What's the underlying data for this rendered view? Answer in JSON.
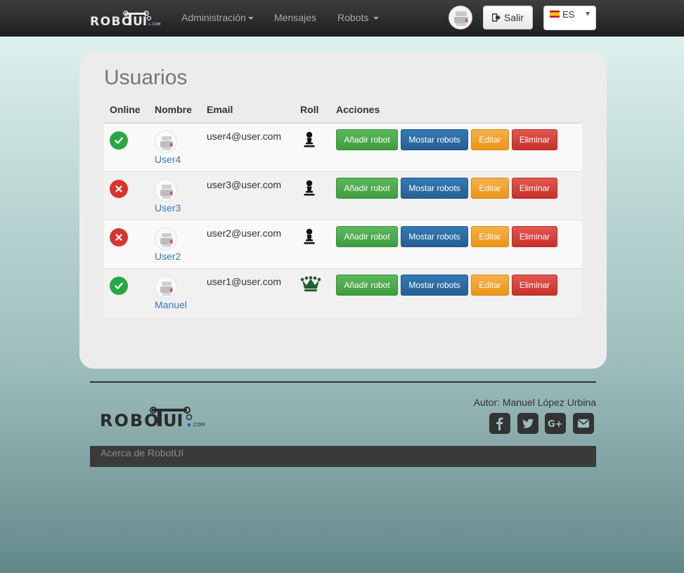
{
  "header": {
    "brand_text": "ROBOTUI",
    "nav": [
      {
        "label": "Administración",
        "dropdown": true
      },
      {
        "label": "Mensajes",
        "dropdown": false
      },
      {
        "label": "Robots",
        "dropdown": true
      }
    ],
    "logout_label": "Salir",
    "language": {
      "selected": "ES",
      "flag": "spain-flag-icon"
    }
  },
  "main": {
    "title": "Usuarios",
    "columns": [
      "Online",
      "Nombre",
      "Email",
      "Roll",
      "Acciones"
    ],
    "actions": {
      "add_robot": "Añadir robot",
      "show_robots": "Mostar robots",
      "edit": "Editar",
      "delete": "Eliminar"
    },
    "users": [
      {
        "online": true,
        "name": "User4",
        "email": "user4@user.com",
        "role": "pawn-icon"
      },
      {
        "online": false,
        "name": "User3",
        "email": "user3@user.com",
        "role": "pawn-icon"
      },
      {
        "online": false,
        "name": "User2",
        "email": "user2@user.com",
        "role": "pawn-icon"
      },
      {
        "online": true,
        "name": "Manuel",
        "email": "user1@user.com",
        "role": "queen-icon"
      }
    ]
  },
  "footer": {
    "author": "Autor: Manuel López Urbina",
    "social": [
      "facebook-icon",
      "twitter-icon",
      "google-plus-icon",
      "email-icon"
    ],
    "about_link": "Acerca de RobotUI"
  },
  "colors": {
    "online": "#27a844",
    "offline": "#d8342f",
    "add_button": "#5cb85c",
    "show_button": "#337ab7",
    "edit_button": "#f0ad4e",
    "delete_button": "#d9534f",
    "link": "#337ab7"
  }
}
